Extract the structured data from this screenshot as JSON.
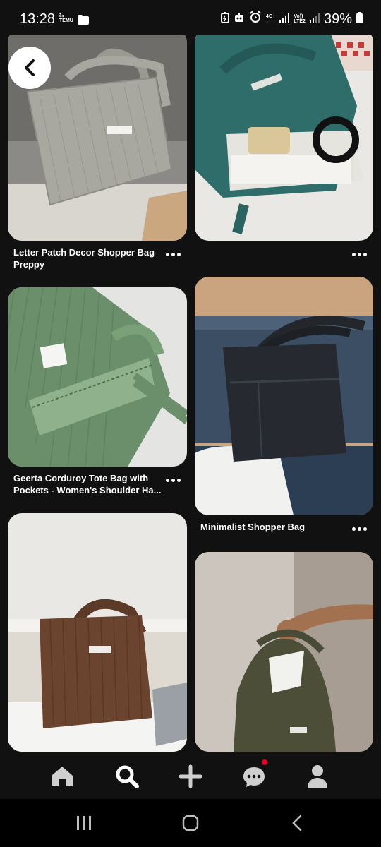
{
  "status_bar": {
    "time": "13:28",
    "notif_label_top": "ခ်ိဳး",
    "notif_label_bottom": "TEMU",
    "network_top": "4G+",
    "volte_top": "Vo))",
    "volte_bottom": "LTE2",
    "battery": "39%"
  },
  "feed": {
    "pins": [
      {
        "title": "Letter Patch Decor Shopper Bag Preppy"
      },
      {
        "title": ""
      },
      {
        "title": "Geerta Corduroy Tote Bag with Pockets - Women's Shoulder Ha..."
      },
      {
        "title": "Minimalist Shopper Bag"
      },
      {
        "title": ""
      },
      {
        "title": ""
      }
    ]
  },
  "bottom_nav": {
    "items": [
      "home-icon",
      "search-icon",
      "create-icon",
      "messages-icon",
      "profile-icon"
    ],
    "active": "search-icon",
    "notification_color": "#e60023"
  },
  "system_nav": [
    "recent-apps-icon",
    "home-circle-icon",
    "back-icon"
  ]
}
